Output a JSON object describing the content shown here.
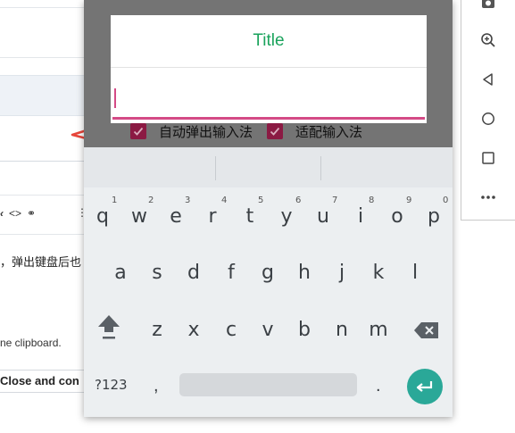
{
  "background_editor": {
    "cn_text": "，弹出键盘后也",
    "clipboard_text": "ne clipboard.",
    "close_button_label": "Close and con"
  },
  "dialog": {
    "title": "Title",
    "input_value": ""
  },
  "options": [
    {
      "label": "自动弹出输入法",
      "checked": true
    },
    {
      "label": "适配输入法",
      "checked": true
    }
  ],
  "keyboard": {
    "row1": [
      "q",
      "w",
      "e",
      "r",
      "t",
      "y",
      "u",
      "i",
      "o",
      "p"
    ],
    "row1_hints": [
      "1",
      "2",
      "3",
      "4",
      "5",
      "6",
      "7",
      "8",
      "9",
      "0"
    ],
    "row2": [
      "a",
      "s",
      "d",
      "f",
      "g",
      "h",
      "j",
      "k",
      "l"
    ],
    "row3": [
      "z",
      "x",
      "c",
      "v",
      "b",
      "n",
      "m"
    ],
    "symbols_key": "?123",
    "comma_key": ",",
    "period_key": "."
  },
  "colors": {
    "title_green": "#1aa35c",
    "input_accent": "#d44a86",
    "checkbox": "#8b1a43",
    "enter_key": "#2aa898",
    "arrow_red": "#e8463a"
  },
  "side_toolbar_icons": [
    "camera-icon",
    "zoom-in-icon",
    "back-icon",
    "home-icon",
    "overview-icon",
    "more-icon"
  ]
}
